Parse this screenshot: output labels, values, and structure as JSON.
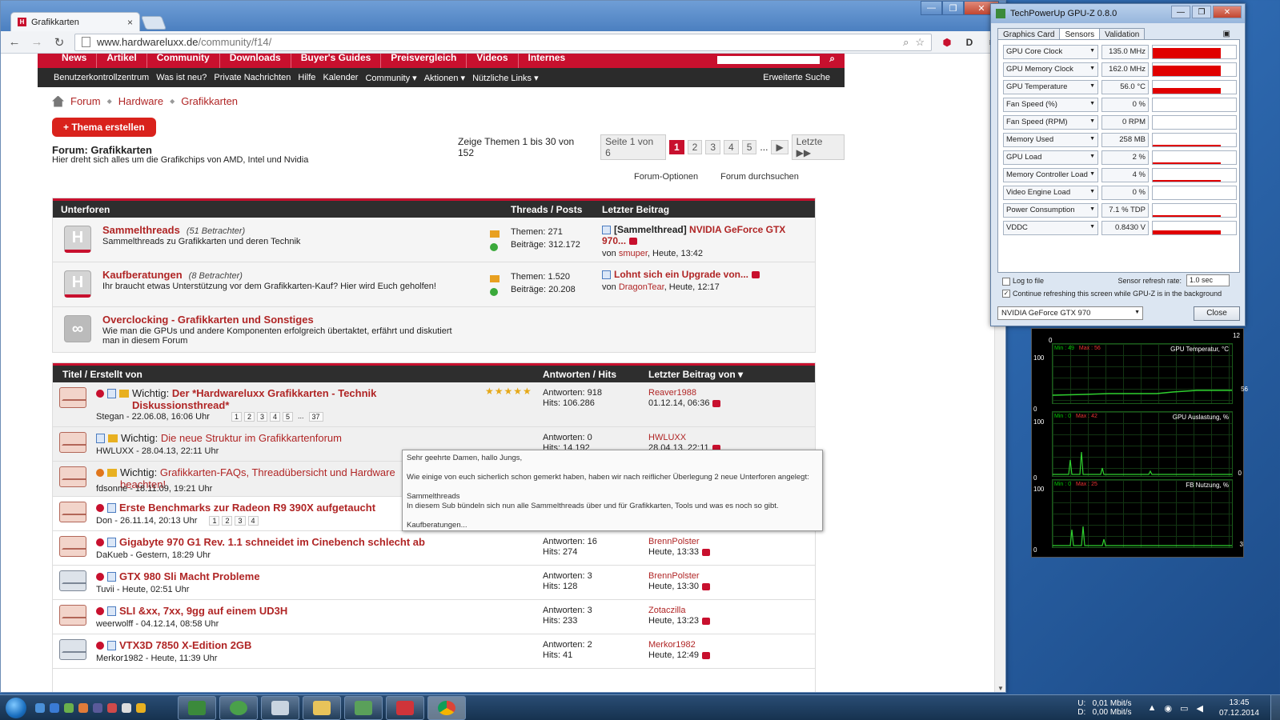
{
  "browser": {
    "tab_title": "Grafikkarten",
    "url_host": "www.hardwareluxx.de",
    "url_path": "/community/f14/"
  },
  "site": {
    "main_nav": [
      "News",
      "Artikel",
      "Community",
      "Downloads",
      "Buyer's Guides",
      "Preisvergleich",
      "Videos",
      "Internes"
    ],
    "sub_nav": [
      "Benutzerkontrollzentrum",
      "Was ist neu?",
      "Private Nachrichten",
      "Hilfe",
      "Kalender",
      "Community ▾",
      "Aktionen ▾",
      "Nützliche Links ▾"
    ],
    "advanced_search": "Erweiterte Suche",
    "breadcrumb": [
      "Forum",
      "Hardware",
      "Grafikkarten"
    ],
    "new_thread_button": "+ Thema erstellen",
    "pager": {
      "info": "Zeige Themen 1 bis 30 von 152",
      "page_of": "Seite 1 von 6",
      "pages": [
        "1",
        "2",
        "3",
        "4",
        "5"
      ],
      "ellipsis": "...",
      "next": "▶",
      "last": "Letzte ▶▶"
    },
    "forum_title": "Forum: Grafikkarten",
    "forum_desc": "Hier dreht sich alles um die Grafikchips von AMD, Intel und Nvidia",
    "forum_options": "Forum-Optionen",
    "forum_search": "Forum durchsuchen",
    "subforum_header": {
      "col1": "Unterforen",
      "col2": "Threads / Posts",
      "col3": "Letzter Beitrag"
    },
    "subforums": [
      {
        "title": "Sammelthreads",
        "viewers": "(51 Betrachter)",
        "desc": "Sammelthreads zu Grafikkarten und deren Technik",
        "threads": "Themen: 271",
        "posts": "Beiträge: 312.172",
        "last_prefix": "[Sammelthread]",
        "last_title": "NVIDIA GeForce GTX 970...",
        "last_by": "von",
        "last_user": "smuper",
        "last_time": ", Heute, 13:42"
      },
      {
        "title": "Kaufberatungen",
        "viewers": "(8 Betrachter)",
        "desc": "Ihr braucht etwas Unterstützung vor dem Grafikkarten-Kauf? Hier wird Euch geholfen!",
        "threads": "Themen: 1.520",
        "posts": "Beiträge: 20.208",
        "last_prefix": "",
        "last_title": "Lohnt sich ein Upgrade von...",
        "last_by": "von",
        "last_user": "DragonTear",
        "last_time": ", Heute, 12:17"
      },
      {
        "title": "Overclocking - Grafikkarten und Sonstiges",
        "viewers": "",
        "desc": "Wie man die GPUs und andere Komponenten erfolgreich übertaktet, erfährt und diskutiert man in diesem Forum",
        "threads": "",
        "posts": "",
        "last_prefix": "",
        "last_title": "",
        "last_by": "",
        "last_user": "",
        "last_time": ""
      }
    ],
    "thread_header": {
      "col1": "Titel / Erstellt von",
      "col2": "Antworten / Hits",
      "col3": "Letzter Beitrag von ▾"
    },
    "threads": [
      {
        "prefix": "Wichtig:",
        "title": "Der *Hardwareluxx Grafikkarten - Technik Diskussionsthread*",
        "meta": "Stegan - 22.06.08, 16:06 Uhr",
        "pages": [
          "1",
          "2",
          "3",
          "4",
          "5",
          "...",
          "37"
        ],
        "replies": "Antworten: 918",
        "hits": "Hits: 106.286",
        "last_user": "Reaver1988",
        "last_time": "01.12.14, 06:36",
        "rating": "★★★★★"
      },
      {
        "prefix": "Wichtig:",
        "title": "Die neue Struktur im Grafikkartenforum",
        "meta": "HWLUXX - 28.04.13, 22:11 Uhr",
        "pages": [],
        "replies": "Antworten: 0",
        "hits": "Hits: 14.192",
        "last_user": "HWLUXX",
        "last_time": "28.04.13, 22:11"
      },
      {
        "prefix": "Wichtig:",
        "title": "Grafikkarten-FAQs, Threadübersicht und Hardware beachten!",
        "meta": "fdsonne - 18.11.09, 19:21 Uhr",
        "pages": [],
        "replies": "",
        "hits": "",
        "last_user": "",
        "last_time": ""
      },
      {
        "prefix": "",
        "title": "Erste Benchmarks zur Radeon R9 390X aufgetaucht",
        "meta": "Don - 26.11.14, 20:13 Uhr",
        "pages": [
          "1",
          "2",
          "3",
          "4"
        ],
        "replies": "",
        "hits": "",
        "last_user": "",
        "last_time": ""
      },
      {
        "prefix": "",
        "title": "Gigabyte 970 G1 Rev. 1.1 schneidet im Cinebench schlecht ab",
        "meta": "DaKueb - Gestern, 18:29 Uhr",
        "pages": [],
        "replies": "Antworten: 16",
        "hits": "Hits: 274",
        "last_user": "BrennPolster",
        "last_time": "Heute, 13:33"
      },
      {
        "prefix": "",
        "title": "GTX 980 Sli Macht Probleme",
        "meta": "Tuvii - Heute, 02:51 Uhr",
        "pages": [],
        "replies": "Antworten: 3",
        "hits": "Hits: 128",
        "last_user": "BrennPolster",
        "last_time": "Heute, 13:30"
      },
      {
        "prefix": "",
        "title": "SLI &xx, 7xx, 9gg auf einem UD3H",
        "meta": "weerwolff - 04.12.14, 08:58 Uhr",
        "pages": [],
        "replies": "Antworten: 3",
        "hits": "Hits: 233",
        "last_user": "Zotaczilla",
        "last_time": "Heute, 13:23"
      },
      {
        "prefix": "",
        "title": "VTX3D 7850 X-Edition 2GB",
        "meta": "Merkor1982 - Heute, 11:39 Uhr",
        "pages": [],
        "replies": "Antworten: 2",
        "hits": "Hits: 41",
        "last_user": "Merkor1982",
        "last_time": "Heute, 12:49"
      }
    ],
    "tooltip": {
      "line1": "Sehr geehrte Damen, hallo Jungs,",
      "line2": "Wie einige von euch sicherlich schon gemerkt haben, haben wir nach reiflicher Überlegung 2 neue Unterforen angelegt:",
      "line3": "Sammelthreads",
      "line4": "In diesem Sub bündeln sich nun alle Sammelthreads über und für Grafikkarten, Tools und was es noch so gibt.",
      "line5": "Kaufberatungen..."
    }
  },
  "gpuz": {
    "title": "TechPowerUp GPU-Z 0.8.0",
    "tabs": [
      "Graphics Card",
      "Sensors",
      "Validation"
    ],
    "sensors": [
      {
        "name": "GPU Core Clock",
        "value": "135.0 MHz",
        "level": 0.8
      },
      {
        "name": "GPU Memory Clock",
        "value": "162.0 MHz",
        "level": 0.8
      },
      {
        "name": "GPU Temperature",
        "value": "56.0 °C",
        "level": 0.45
      },
      {
        "name": "Fan Speed (%)",
        "value": "0 %",
        "level": 0
      },
      {
        "name": "Fan Speed (RPM)",
        "value": "0 RPM",
        "level": 0
      },
      {
        "name": "Memory Used",
        "value": "258 MB",
        "level": 0.06
      },
      {
        "name": "GPU Load",
        "value": "2 %",
        "level": 0.02
      },
      {
        "name": "Memory Controller Load",
        "value": "4 %",
        "level": 0.04
      },
      {
        "name": "Video Engine Load",
        "value": "0 %",
        "level": 0
      },
      {
        "name": "Power Consumption",
        "value": "7.1 % TDP",
        "level": 0.07
      },
      {
        "name": "VDDC",
        "value": "0.8430 V",
        "level": 0.3
      }
    ],
    "log_to_file": "Log to file",
    "continue_refresh": "Continue refreshing this screen while GPU-Z is in the background",
    "refresh_rate_label": "Sensor refresh rate:",
    "refresh_rate": "1.0 sec",
    "gpu_select": "NVIDIA GeForce GTX 970",
    "close": "Close"
  },
  "monitor": {
    "graphs": [
      {
        "title": "GPU Temperatur, °C",
        "min": "Min : 49",
        "max": "Max : 56",
        "top": "100",
        "bottom": "0",
        "right_top": "12",
        "right_val": "56"
      },
      {
        "title": "GPU Auslastung, %",
        "min": "Min : 0",
        "max": "Max : 42",
        "top": "100",
        "bottom": "0",
        "right_top": "",
        "right_val": "0"
      },
      {
        "title": "FB Nutzung, %",
        "min": "Min : 0",
        "max": "Max : 25",
        "top": "100",
        "bottom": "0",
        "right_top": "",
        "right_val": "3"
      }
    ]
  },
  "taskbar": {
    "net_up": "U:",
    "net_down": "D:",
    "net_up_val": "0,01 Mbit/s",
    "net_down_val": "0,00 Mbit/s",
    "time": "13:45",
    "date": "07.12.2014"
  },
  "colors": {
    "brand": "#c8102e",
    "dark_header": "#2e2e2e"
  }
}
